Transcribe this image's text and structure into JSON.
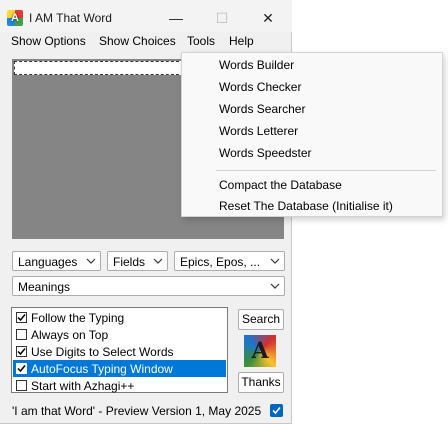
{
  "window": {
    "title": "I AM That Word",
    "icon_letter": "A",
    "controls": {
      "minimize": "—",
      "maximize": "☐",
      "close": "✕"
    }
  },
  "menu": [
    "Show Options",
    "Show Choices",
    "Tools",
    "Help"
  ],
  "tools_menu": {
    "items": [
      "Words Builder",
      "Words Checker",
      "Words Searcher",
      "Words Letterer",
      "Words Speedster"
    ],
    "items2": [
      "Compact the Database",
      "Reset The Database (Initialise it)"
    ]
  },
  "dropdowns": {
    "languages": "Languages",
    "fields": "Fields",
    "epics": "Epics, Epos, ...",
    "meanings": "Meanings"
  },
  "options": [
    {
      "label": "Follow the Typing",
      "checked": true,
      "selected": false
    },
    {
      "label": "Always on Top",
      "checked": false,
      "selected": false
    },
    {
      "label": "Use Digits to Select Words",
      "checked": true,
      "selected": false
    },
    {
      "label": "AutoFocus Typing Window",
      "checked": true,
      "selected": true
    },
    {
      "label": "Start with Azhagi++",
      "checked": false,
      "selected": false
    }
  ],
  "buttons": {
    "search": "Search",
    "thanks": "Thanks"
  },
  "logo_letter": "A",
  "status_text": "'I am that Word' - Preview Version 1, May 2025",
  "status_checked": true,
  "colors": {
    "selection": "#0078d7",
    "edit_area": "#858585",
    "accent": "#0067c0"
  }
}
